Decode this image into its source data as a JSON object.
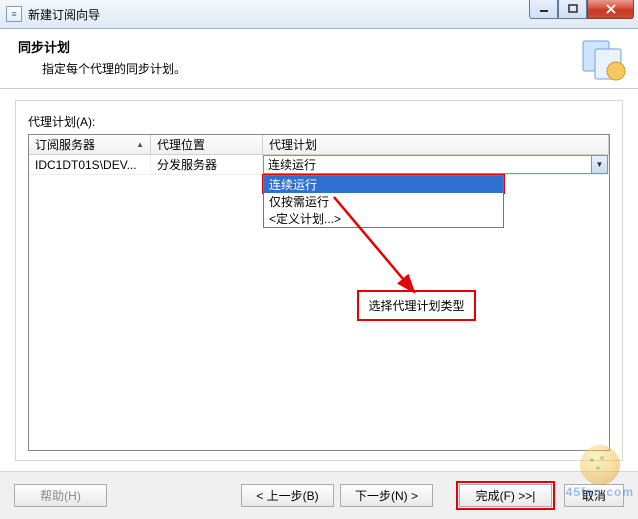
{
  "window": {
    "title": "新建订阅向导",
    "min_tip": "最小化",
    "max_tip": "最大化",
    "close_tip": "关闭"
  },
  "header": {
    "title": "同步计划",
    "subtitle": "指定每个代理的同步计划。"
  },
  "body": {
    "section_label": "代理计划(A):",
    "columns": {
      "c1": "订阅服务器",
      "c2": "代理位置",
      "c3": "代理计划"
    },
    "row": {
      "server": "IDC1DT01S\\DEV...",
      "location": "分发服务器",
      "schedule_selected": "连续运行"
    },
    "dropdown": {
      "items": [
        "连续运行",
        "仅按需运行",
        "<定义计划...>"
      ],
      "selected_index": 0
    },
    "annotation_label": "选择代理计划类型"
  },
  "footer": {
    "help": "帮助(H)",
    "back": "< 上一步(B)",
    "next": "下一步(N) >",
    "finish": "完成(F) >>|",
    "cancel": "取消"
  },
  "watermark": "45fan.com"
}
